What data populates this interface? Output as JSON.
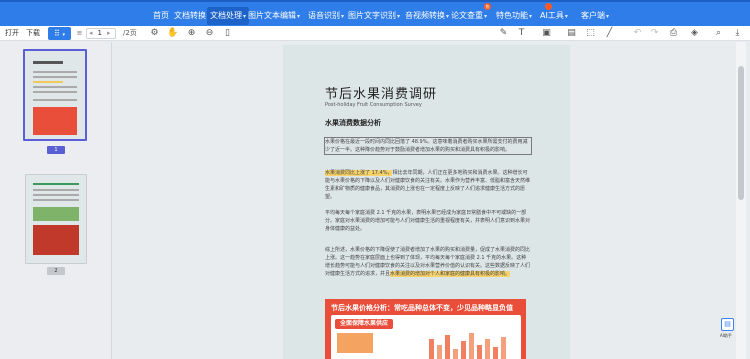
{
  "nav": {
    "items": [
      {
        "label": "首页",
        "arrow": ""
      },
      {
        "label": "文档转换",
        "arrow": "▾"
      },
      {
        "label": "文档处理",
        "arrow": "▾"
      },
      {
        "label": "图片文本编辑",
        "arrow": "▾"
      },
      {
        "label": "语音识别",
        "arrow": "▾"
      },
      {
        "label": "图片文字识别",
        "arrow": "▾"
      },
      {
        "label": "音视频转换",
        "arrow": "▾"
      },
      {
        "label": "论文查重",
        "arrow": "▾"
      },
      {
        "label": "特色功能",
        "arrow": "▾"
      },
      {
        "label": "AI工具",
        "arrow": "▾"
      },
      {
        "label": "客户端",
        "arrow": "▾"
      }
    ],
    "active_index": 2,
    "hot_badge": "热"
  },
  "toolbar": {
    "open_label": "打开",
    "download_label": "下载",
    "page_input": "1",
    "page_total": "/2页",
    "page_prev": "◂",
    "page_next": "▸"
  },
  "sidebar": {
    "pages": [
      "1",
      "2"
    ],
    "active_page": "1"
  },
  "document": {
    "title": "节后水果消费调研",
    "subtitle": "Post-holiday Fruit Consumption Survey",
    "section_heading": "水果消费数据分析",
    "p1": "水果价格在最近一段时间内同比回落了 48.9%。这意味着消费者购买水果所需支付的费用减少了近一半。这种降价趋势对于鼓励消费者增加水果的购买和消费具有积极的影响。",
    "p2_highlight": "水果消费同比上涨了 17.4%，",
    "p2_rest": "相比去年同期，人们正在更多地购买和消费水果。这种增长可能与水果价格的下降以及人们对健康饮食的关注有关。水果作为营养丰富、低脂和富含天然维生素和矿物质的健康食品，其消费的上涨也在一定程度上反映了人们追求健康生活方式的愿望。",
    "p3": "平均每天每个家庭消费 2.1 千克的水果，表明水果已经成为家庭日常膳食中不可或缺的一部分。家庭对水果消费的增加可能与人们对健康生活的重视程度有关，并表明人们意识到水果对身体健康的益处。",
    "p4_normal": "综上所述，水果价格的下降促使了消费者增加了水果的购买和消费量，促成了水果消费的同比上涨。这一趋势在家庭层面上也得到了体现，平均每天每个家庭消费 2.1 千克的水果。这种增长趋势可能与人们对健康饮食的关注以及对水果营养价值的认识有关。这些数据反映了人们对健康生活方式的追求，并且",
    "p4_highlight": "水果消费的增加对个人和家庭的健康具有积极的影响。",
    "card_title": "节后水果价格分析：常吃品种总体不变，少见品种略显负值",
    "card_tag": "全面保障水果供应"
  },
  "fab": {
    "icon": "doc-icon",
    "label": "AI助手"
  },
  "colors": {
    "nav": "#2f7de8",
    "highlight": "#f7d26a",
    "card": "#e94e3a"
  }
}
